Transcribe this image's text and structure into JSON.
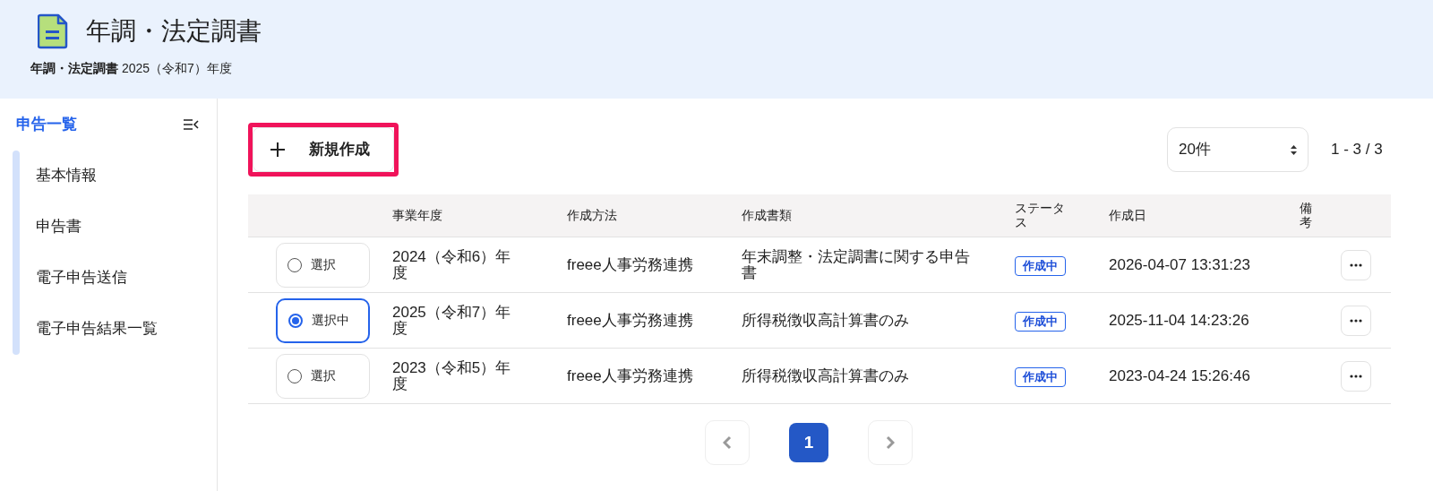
{
  "header": {
    "title": "年調・法定調書",
    "breadcrumb": "**年調・法定調書** 2025（令和7）年度"
  },
  "sidebar": {
    "title": "申告一覧",
    "items": [
      {
        "label": "基本情報"
      },
      {
        "label": "申告書"
      },
      {
        "label": "電子申告送信"
      },
      {
        "label": "電子申告結果一覧"
      }
    ]
  },
  "toolbar": {
    "new_button": "新規作成",
    "highlighted": true,
    "per_page": "20件",
    "range": "1 - 3 / 3"
  },
  "table": {
    "columns": [
      "事業年度",
      "作成方法",
      "作成書類",
      "ステータス",
      "作成日",
      "備考"
    ],
    "rows": [
      {
        "select_label": "選択",
        "selected": false,
        "year": "2024（令和6）年度",
        "method": "freee人事労務連携",
        "documents": "年末調整・法定調書に関する申告書",
        "status": "作成中",
        "created": "2026-04-07 13:31:23"
      },
      {
        "select_label": "選択中",
        "selected": true,
        "year": "2025（令和7）年度",
        "method": "freee人事労務連携",
        "documents": "所得税徴収高計算書のみ",
        "status": "作成中",
        "created": "2025-11-04 14:23:26"
      },
      {
        "select_label": "選択",
        "selected": false,
        "year": "2023（令和5）年度",
        "method": "freee人事労務連携",
        "documents": "所得税徴収高計算書のみ",
        "status": "作成中",
        "created": "2023-04-24 15:26:46"
      }
    ]
  },
  "pagination": {
    "pages": [
      {
        "label": "1",
        "selected": true
      }
    ]
  }
}
